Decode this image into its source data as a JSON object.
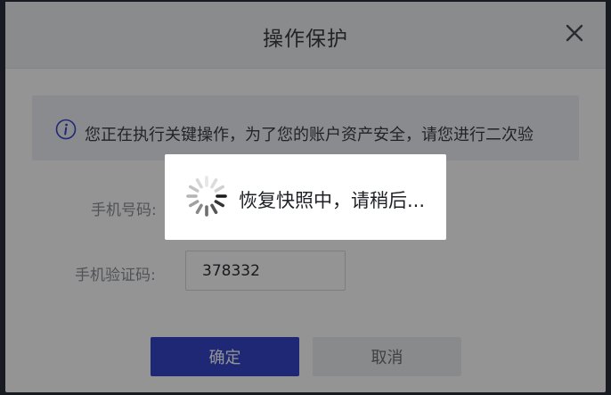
{
  "dialog": {
    "title": "操作保护",
    "close_icon": "close-icon",
    "notice": {
      "icon": "info-icon",
      "text": "您正在执行关键操作，为了您的账户资产安全，请您进行二次验"
    },
    "phone_label": "手机号码:",
    "code_label": "手机验证码:",
    "code_value": "378332",
    "confirm_label": "确定",
    "cancel_label": "取消"
  },
  "loading": {
    "icon": "spinner-icon",
    "text": "恢复快照中，请稍后..."
  },
  "colors": {
    "primary": "#3546c9",
    "overlay": "rgba(0,0,0,0.42)"
  }
}
